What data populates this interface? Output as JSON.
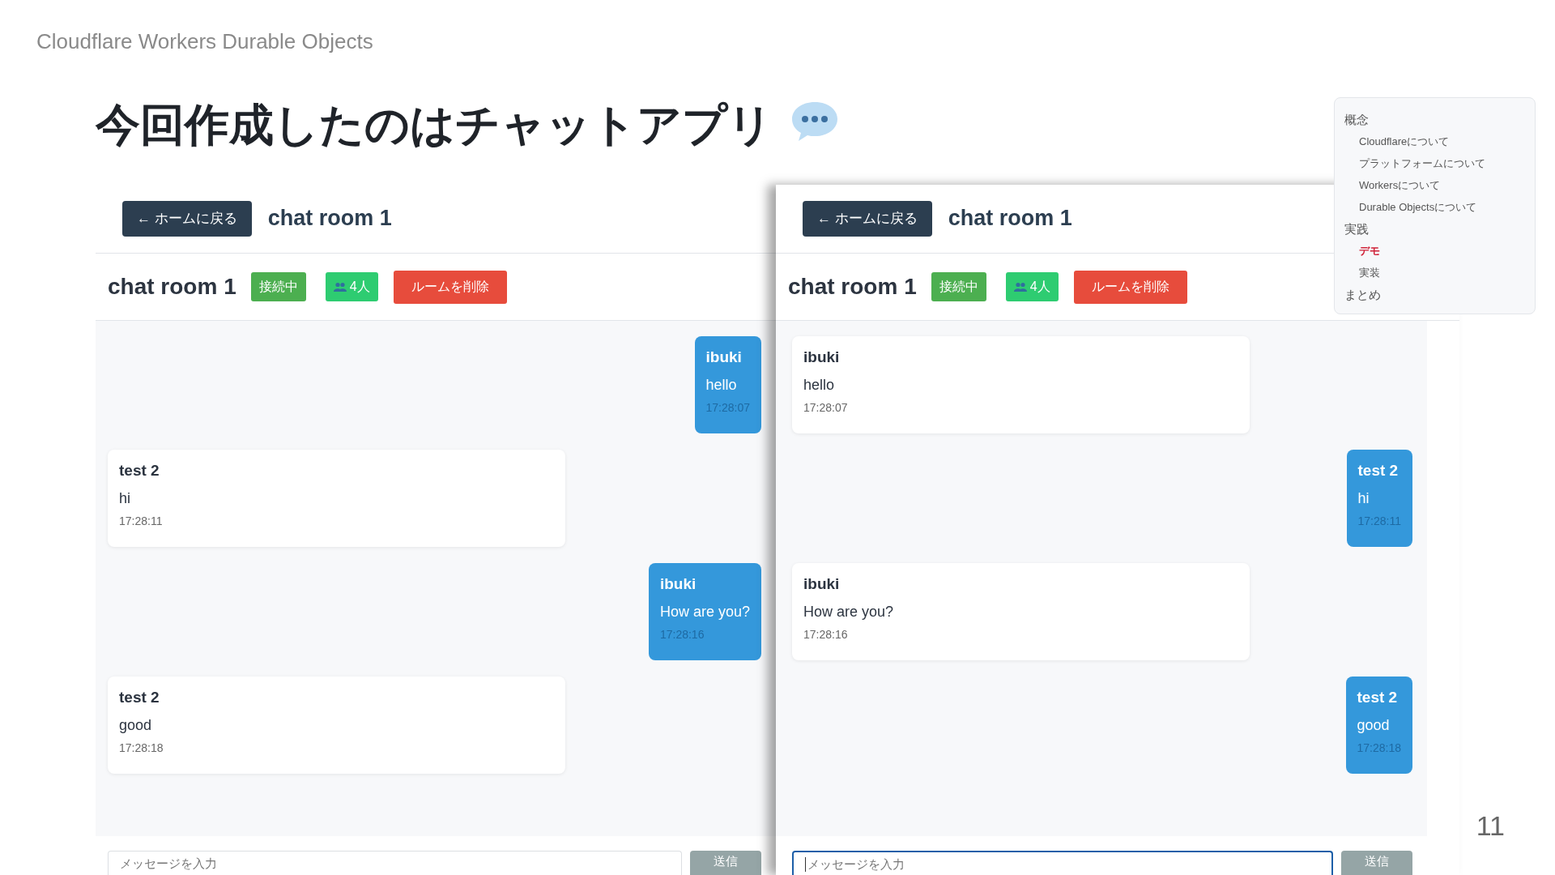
{
  "header": "Cloudflare Workers Durable Objects",
  "title": "今回作成したのはチャットアプリ",
  "panels": [
    {
      "back_button": "← ホームに戻る",
      "top_title": "chat room 1",
      "room_name": "chat room 1",
      "status": "接続中",
      "members": "4人",
      "delete_button": "ルームを削除",
      "messages": [
        {
          "sender": "ibuki",
          "text": "hello",
          "time": "17:28:07",
          "own": true
        },
        {
          "sender": "test 2",
          "text": "hi",
          "time": "17:28:11",
          "own": false
        },
        {
          "sender": "ibuki",
          "text": "How are you?",
          "time": "17:28:16",
          "own": true
        },
        {
          "sender": "test 2",
          "text": "good",
          "time": "17:28:18",
          "own": false
        }
      ],
      "input": {
        "placeholder": "メッセージを入力",
        "focused": false
      },
      "send_button": {
        "label": "送信",
        "disabled": true
      }
    },
    {
      "back_button": "← ホームに戻る",
      "top_title": "chat room 1",
      "room_name": "chat room 1",
      "status": "接続中",
      "members": "4人",
      "delete_button": "ルームを削除",
      "messages": [
        {
          "sender": "ibuki",
          "text": "hello",
          "time": "17:28:07",
          "own": false
        },
        {
          "sender": "test 2",
          "text": "hi",
          "time": "17:28:11",
          "own": true
        },
        {
          "sender": "ibuki",
          "text": "How are you?",
          "time": "17:28:16",
          "own": false
        },
        {
          "sender": "test 2",
          "text": "good",
          "time": "17:28:18",
          "own": true
        }
      ],
      "input": {
        "placeholder": "メッセージを入力",
        "focused": true
      },
      "send_button": {
        "label": "送信",
        "disabled": true
      }
    }
  ],
  "toc": [
    {
      "label": "概念",
      "selected": false,
      "children": [
        {
          "label": "Cloudflareについて",
          "selected": false
        },
        {
          "label": "プラットフォームについて",
          "selected": false
        },
        {
          "label": "Workersについて",
          "selected": false
        },
        {
          "label": "Durable Objectsについて",
          "selected": false
        }
      ]
    },
    {
      "label": "実践",
      "selected": false,
      "children": [
        {
          "label": "デモ",
          "selected": true
        },
        {
          "label": "実装",
          "selected": false
        }
      ]
    },
    {
      "label": "まとめ",
      "selected": false
    }
  ],
  "page_number": "11"
}
